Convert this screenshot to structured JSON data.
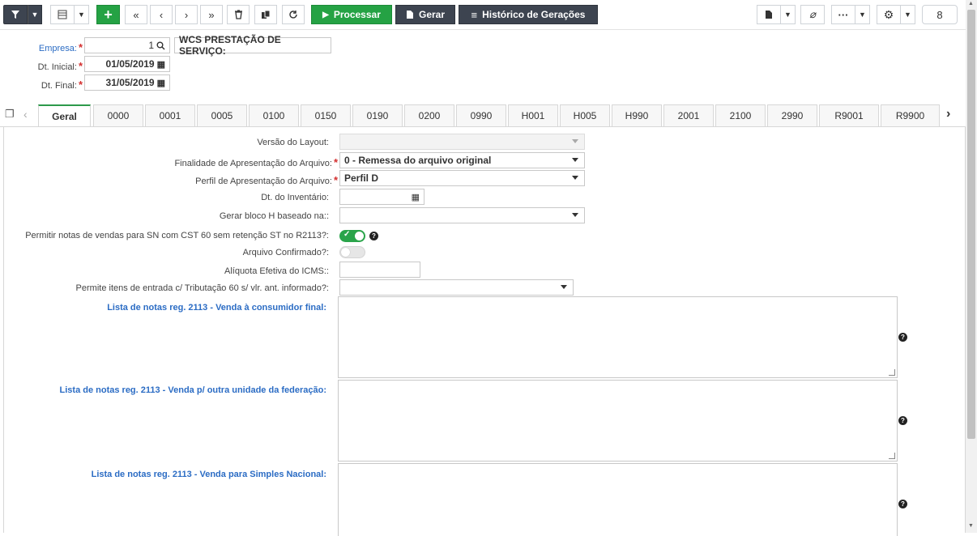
{
  "toolbar": {
    "processar_label": "Processar",
    "gerar_label": "Gerar",
    "historico_label": "Histórico de Gerações",
    "counter": "8"
  },
  "header": {
    "empresa_label": "Empresa:",
    "empresa_code": "1",
    "empresa_name": "WCS PRESTAÇÃO DE SERVIÇO:",
    "dt_inicial_label": "Dt. Inicial:",
    "dt_inicial": "01/05/2019",
    "dt_final_label": "Dt. Final:",
    "dt_final": "31/05/2019",
    "required_mark": "*"
  },
  "tabs": [
    {
      "label": "Geral"
    },
    {
      "label": "0000"
    },
    {
      "label": "0001"
    },
    {
      "label": "0005"
    },
    {
      "label": "0100"
    },
    {
      "label": "0150"
    },
    {
      "label": "0190"
    },
    {
      "label": "0200"
    },
    {
      "label": "0990"
    },
    {
      "label": "H001"
    },
    {
      "label": "H005"
    },
    {
      "label": "H990"
    },
    {
      "label": "2001"
    },
    {
      "label": "2100"
    },
    {
      "label": "2990"
    },
    {
      "label": "R9001"
    },
    {
      "label": "R9900"
    }
  ],
  "form": {
    "versao_label": "Versão do Layout:",
    "versao_value": "",
    "finalidade_label": "Finalidade de Apresentação do Arquivo:",
    "finalidade_value": "0 - Remessa do arquivo original",
    "perfil_label": "Perfil de Apresentação do Arquivo:",
    "perfil_value": "Perfil D",
    "inventario_label": "Dt. do Inventário:",
    "inventario_value": "",
    "bloco_h_label": "Gerar bloco H baseado na::",
    "bloco_h_value": "",
    "permitir_label": "Permitir notas de vendas para SN com CST 60 sem retenção ST no R2113?:",
    "permitir_on": true,
    "confirmado_label": "Arquivo Confirmado?:",
    "confirmado_on": false,
    "aliquota_label": "Alíquota Efetiva do ICMS::",
    "aliquota_value": "",
    "permite_itens_label": "Permite itens de entrada c/ Tributação 60 s/ vlr. ant. informado?:",
    "permite_itens_value": "",
    "lista1_label": "Lista de notas reg. 2113 - Venda à consumidor final:",
    "lista2_label": "Lista de notas reg. 2113 - Venda p/ outra unidade da federação:",
    "lista3_label": "Lista de notas reg. 2113 - Venda para Simples Nacional:"
  }
}
